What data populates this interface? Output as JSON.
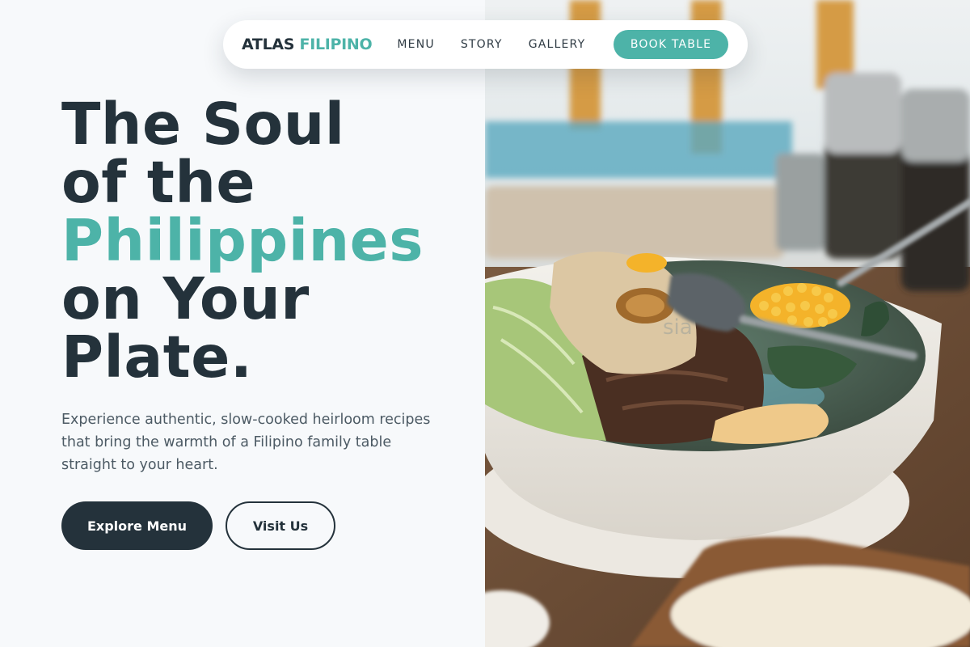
{
  "nav": {
    "brand_main": "ATLAS",
    "brand_accent": "FILIPINO",
    "links": [
      "MENU",
      "STORY",
      "GALLERY"
    ],
    "cta": "BOOK TABLE"
  },
  "hero": {
    "headline_line1": "The Soul",
    "headline_line2": "of the",
    "headline_accent": "Philippines",
    "headline_line4": "on Your",
    "headline_line5": "Plate.",
    "subtext": "Experience authentic, slow-cooked heirloom recipes that bring the warmth of a Filipino family table straight to your heart.",
    "primary_button": "Explore Menu",
    "secondary_button": "Visit Us"
  },
  "photo": {
    "watermark": "sia"
  },
  "colors": {
    "accent": "#4db3a8",
    "dark": "#24323b",
    "background": "#f7f9fb"
  }
}
